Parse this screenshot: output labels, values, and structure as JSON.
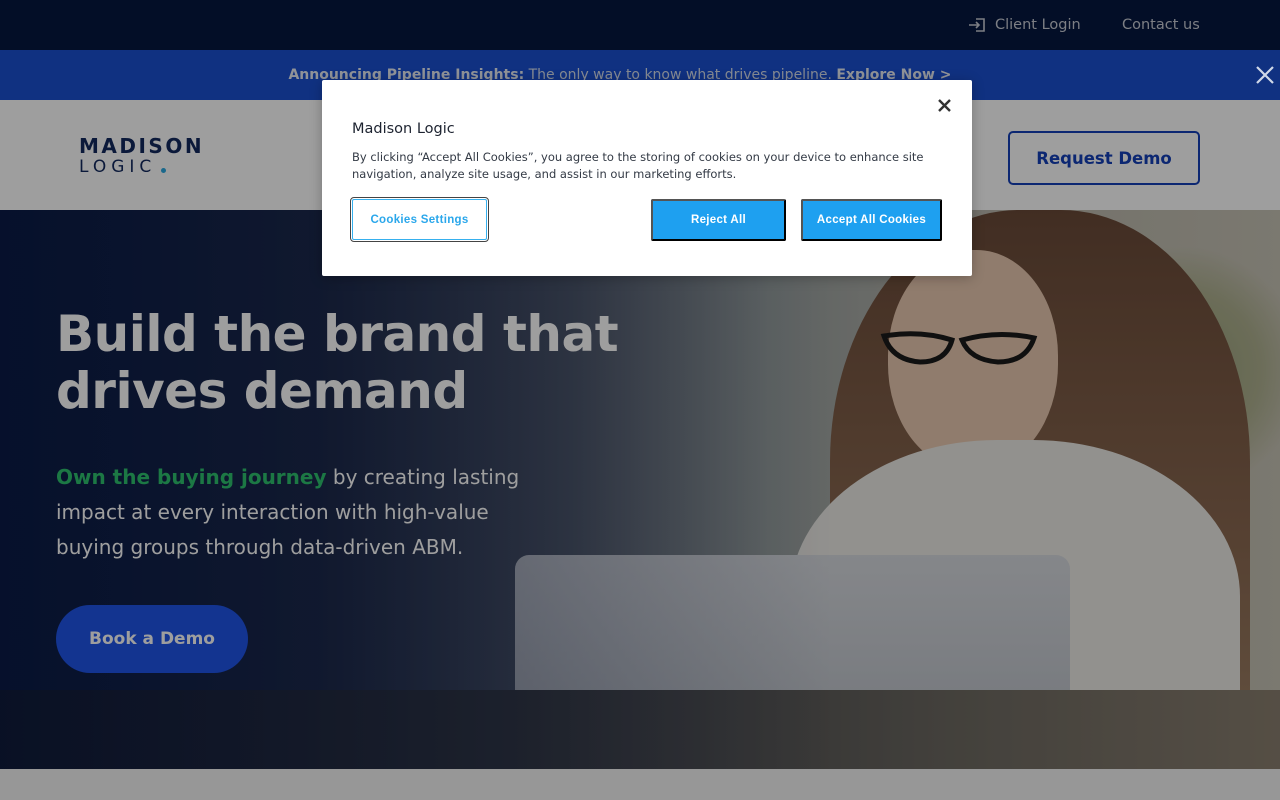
{
  "topbar": {
    "client_login": "Client Login",
    "contact_us": "Contact us"
  },
  "announcement": {
    "label": "Announcing Pipeline Insights:",
    "text": " The only way to know what drives pipeline. ",
    "link": "Explore Now >"
  },
  "header": {
    "logo_line1": "MADISON",
    "logo_line2": "LOGIC",
    "request_demo": "Request Demo"
  },
  "hero": {
    "title": "Build the brand that drives demand",
    "subtitle_accent": "Own the buying journey",
    "subtitle_rest": " by creating lasting impact at every interaction with high-value buying groups through data-driven ABM.",
    "cta": "Book a Demo"
  },
  "cookie_modal": {
    "title": "Madison Logic",
    "body": "By clicking “Accept All Cookies”, you agree to the storing of cookies on your device to enhance site navigation, analyze site usage, and assist in our marketing efforts.",
    "settings_button": "Cookies Settings",
    "reject_button": "Reject All",
    "accept_button": "Accept All Cookies"
  },
  "colors": {
    "topbar": "#06183f",
    "announcement": "#1b4fd0",
    "brand_blue": "#1440b8",
    "accent_green": "#2ec26f",
    "cookie_button": "#1ea0f0"
  },
  "icons": {
    "login": "login-icon",
    "close": "close-icon"
  }
}
